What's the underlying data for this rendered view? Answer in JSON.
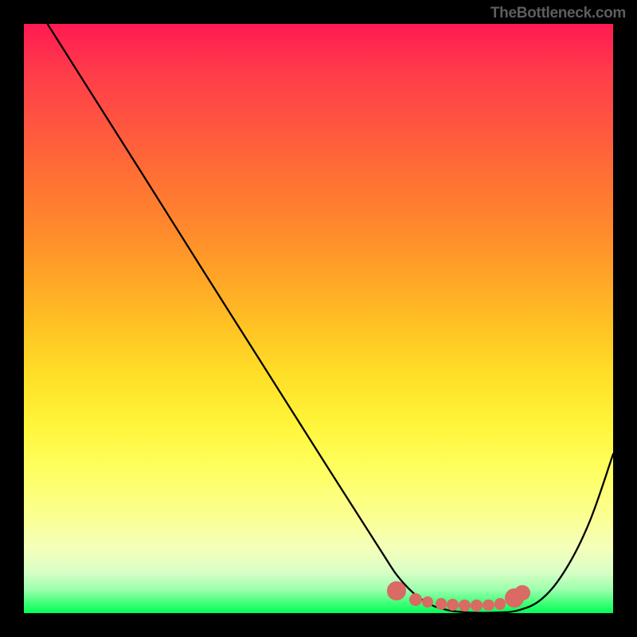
{
  "attribution": "TheBottleneck.com",
  "chart_data": {
    "type": "line",
    "title": "",
    "xlabel": "",
    "ylabel": "",
    "xlim": [
      0,
      100
    ],
    "ylim": [
      0,
      100
    ],
    "series": [
      {
        "name": "curve",
        "x": [
          4,
          10,
          20,
          30,
          40,
          50,
          60,
          64,
          68,
          72,
          76,
          80,
          84,
          88,
          92,
          96,
          100
        ],
        "y": [
          100,
          90.5,
          74.7,
          58.8,
          43.0,
          27.2,
          11.5,
          5.6,
          2.0,
          0.5,
          0.1,
          0.1,
          0.5,
          2.5,
          7.5,
          15.5,
          27.0
        ]
      }
    ],
    "markers": {
      "name": "bottom-dots",
      "color": "#d96a64",
      "points": [
        {
          "x": 63.2,
          "y": 3.8,
          "r": 1.6
        },
        {
          "x": 66.5,
          "y": 2.3,
          "r": 1.1
        },
        {
          "x": 68.5,
          "y": 1.9,
          "r": 1.0
        },
        {
          "x": 70.8,
          "y": 1.6,
          "r": 1.0
        },
        {
          "x": 72.8,
          "y": 1.4,
          "r": 1.0
        },
        {
          "x": 74.8,
          "y": 1.25,
          "r": 1.0
        },
        {
          "x": 76.8,
          "y": 1.25,
          "r": 1.0
        },
        {
          "x": 78.8,
          "y": 1.35,
          "r": 1.0
        },
        {
          "x": 80.8,
          "y": 1.55,
          "r": 1.0
        },
        {
          "x": 83.2,
          "y": 2.6,
          "r": 1.6
        },
        {
          "x": 84.6,
          "y": 3.4,
          "r": 1.3
        }
      ]
    },
    "background_gradient": {
      "top": "#ff1a52",
      "bottom": "#00ff57"
    }
  }
}
